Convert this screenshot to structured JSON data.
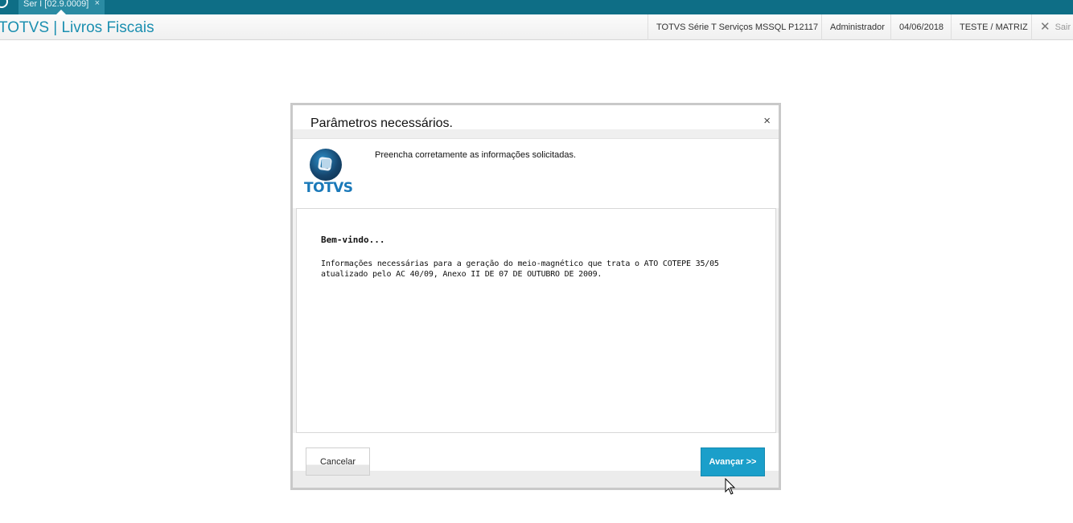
{
  "topbar": {
    "tab_label": "Ser I [02.9.0009]",
    "tab_close": "×"
  },
  "header": {
    "app_title": "TOTVS | Livros Fiscais",
    "environment": "TOTVS Série T Serviços MSSQL P12117",
    "user": "Administrador",
    "date": "04/06/2018",
    "company": "TESTE / MATRIZ",
    "exit_label": "Sair"
  },
  "dialog": {
    "title": "Parâmetros necessários.",
    "close": "×",
    "logo_text": "TOTVS",
    "subtitle": "Preencha corretamente as informações solicitadas.",
    "welcome_title": "Bem-vindo...",
    "welcome_text": "Informações necessárias para a geração do meio-magnético que trata o ATO COTEPE 35/05 atualizado pelo AC 40/09, Anexo II DE 07 DE OUTUBRO DE 2009.",
    "cancel_label": "Cancelar",
    "next_label": "Avançar >>"
  },
  "colors": {
    "topbar": "#0e6e86",
    "accent": "#1b8fb0",
    "primary_button": "#1b9fca"
  }
}
